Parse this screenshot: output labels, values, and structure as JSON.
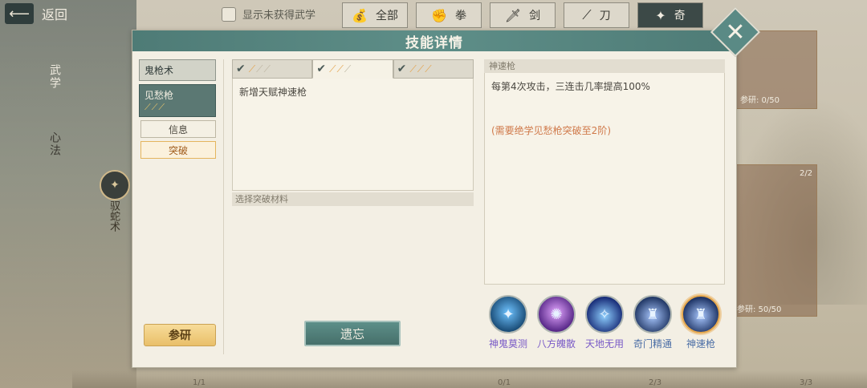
{
  "topbar": {
    "back_label": "返回",
    "show_unobtained_label": "显示未获得武学",
    "filters": [
      {
        "label": "全部",
        "icon": "pouch-icon",
        "glyph": "💰",
        "active": false
      },
      {
        "label": "拳",
        "icon": "fist-icon",
        "glyph": "✊",
        "active": false
      },
      {
        "label": "剑",
        "icon": "sword-icon",
        "glyph": "🗡",
        "active": false
      },
      {
        "label": "刀",
        "icon": "blade-icon",
        "glyph": "⟋",
        "active": false
      },
      {
        "label": "奇",
        "icon": "shuriken-icon",
        "glyph": "✦",
        "active": true
      }
    ]
  },
  "background": {
    "side_tabs": [
      "武学",
      "心法"
    ],
    "side_skill": "驭蛇术",
    "card_labels": [
      "参研: 0/50",
      "2/2",
      "参研: 50/50"
    ],
    "bottom_counters": [
      "1/1",
      "0/1",
      "2/3",
      "3/3"
    ]
  },
  "dialog": {
    "title": "技能详情",
    "close_glyph": "✕",
    "skill_tabs": [
      {
        "label": "鬼枪术",
        "marks": "",
        "selected": false
      },
      {
        "label": "见愁枪",
        "marks": "⟋⟋⟋",
        "selected": true
      }
    ],
    "sub_buttons": [
      {
        "label": "信息",
        "active": false
      },
      {
        "label": "突破",
        "active": true
      }
    ],
    "research_label": "参研",
    "tiers": [
      {
        "check": "✔",
        "lit": "⟋",
        "dim": "⟋⟋",
        "selected": false
      },
      {
        "check": "✔",
        "lit": "⟋⟋",
        "dim": "⟋",
        "selected": true
      },
      {
        "check": "✔",
        "lit": "⟋⟋⟋",
        "dim": "",
        "selected": false
      }
    ],
    "tier_text": "新增天赋神速枪",
    "material_header": "选择突破材料",
    "forget_label": "遗忘",
    "desc_header": "神速枪",
    "desc_main": "每第4次攻击，三连击几率提高100%",
    "desc_requirement": "(需要绝学见愁枪突破至2阶)",
    "skills": [
      {
        "name": "神鬼莫测",
        "icon": "ghost-spear-icon",
        "color": "#7a5bc7",
        "orb": "#1c4f7a",
        "selected": false
      },
      {
        "name": "八方魄散",
        "icon": "scatter-icon",
        "color": "#7a5bc7",
        "orb": "#5a2a8a",
        "selected": false
      },
      {
        "name": "天地无用",
        "icon": "heaven-icon",
        "color": "#7a5bc7",
        "orb": "#1a2f7a",
        "selected": false
      },
      {
        "name": "奇门精通",
        "icon": "mastery-icon",
        "color": "#4b6ea6",
        "orb": "#243a68",
        "selected": false
      },
      {
        "name": "神速枪",
        "icon": "swift-spear-icon",
        "color": "#4b6ea6",
        "orb": "#1f3566",
        "selected": true
      }
    ]
  }
}
